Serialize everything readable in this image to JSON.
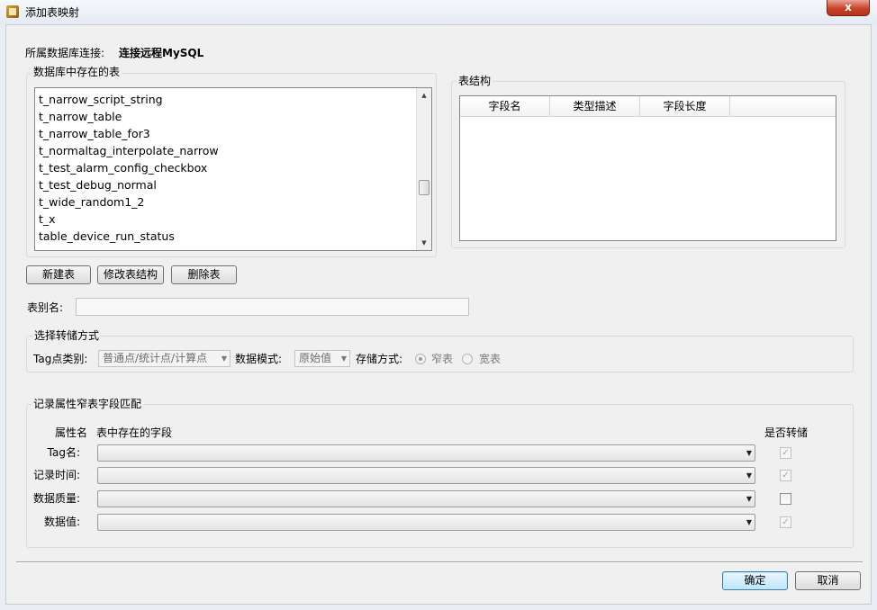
{
  "window": {
    "title": "添加表映射",
    "close_glyph": "x"
  },
  "connection": {
    "label": "所属数据库连接:",
    "value": "连接远程MySQL"
  },
  "tables_group": {
    "legend": "数据库中存在的表",
    "items": [
      "t_narrow_script_string",
      "t_narrow_table",
      "t_narrow_table_for3",
      "t_normaltag_interpolate_narrow",
      "t_test_alarm_config_checkbox",
      "t_test_debug_normal",
      "t_wide_random1_2",
      "t_x",
      "table_device_run_status"
    ]
  },
  "structure_group": {
    "legend": "表结构",
    "columns": [
      "字段名",
      "类型描述",
      "字段长度"
    ]
  },
  "buttons": {
    "new_table": "新建表",
    "modify_table": "修改表结构",
    "delete_table": "删除表",
    "ok": "确定",
    "cancel": "取消"
  },
  "alias": {
    "label": "表别名:",
    "value": ""
  },
  "storage_group": {
    "legend": "选择转储方式",
    "tag_type_label": "Tag点类别:",
    "tag_type_value": "普通点/统计点/计算点",
    "data_mode_label": "数据模式:",
    "data_mode_value": "原始值",
    "storage_label": "存储方式:",
    "narrow_label": "窄表",
    "wide_label": "宽表",
    "narrow_selected": true
  },
  "mapping_group": {
    "legend": "记录属性窄表字段匹配",
    "header_attr": "属性名",
    "header_field": "表中存在的字段",
    "header_dump": "是否转储",
    "rows": [
      {
        "label": "Tag名:",
        "value": "",
        "checked": true,
        "enabled": false
      },
      {
        "label": "记录时间:",
        "value": "",
        "checked": true,
        "enabled": false
      },
      {
        "label": "数据质量:",
        "value": "",
        "checked": false,
        "enabled": true
      },
      {
        "label": "数据值:",
        "value": "",
        "checked": true,
        "enabled": false
      }
    ]
  }
}
